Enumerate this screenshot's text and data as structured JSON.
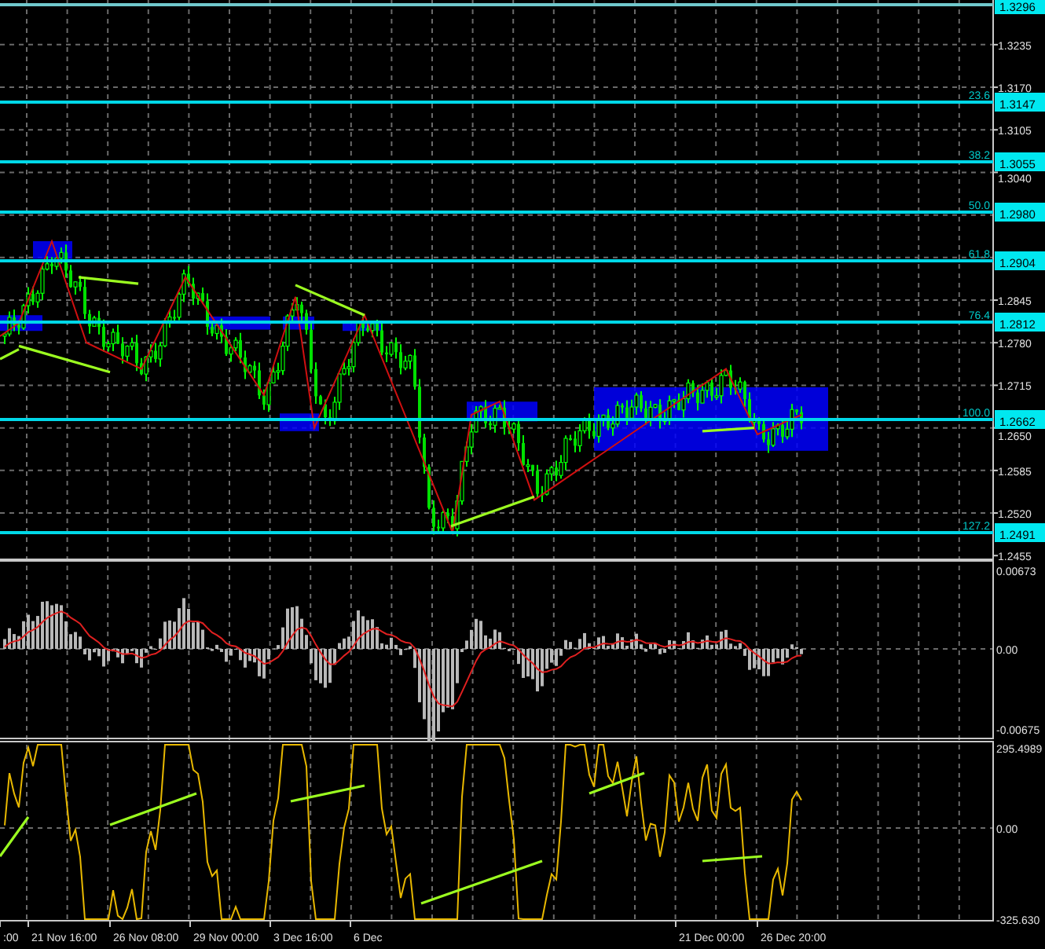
{
  "price_pane": {
    "axis_labels": [
      "1.3235",
      "1.3170",
      "1.3105",
      "1.3040",
      "1.2845",
      "1.2780",
      "1.2715",
      "1.2650",
      "1.2585",
      "1.2520",
      "1.2455"
    ],
    "levels": [
      {
        "price": "1.3296"
      },
      {
        "price": "1.3147",
        "fib": "23.6"
      },
      {
        "price": "1.3055",
        "fib": "38.2"
      },
      {
        "price": "1.2980",
        "fib": "50.0"
      },
      {
        "price": "1.2904",
        "fib": "61.8"
      },
      {
        "price": "1.2812",
        "fib": "76.4"
      },
      {
        "price": "1.2662",
        "fib": "100.0"
      },
      {
        "price": "1.2491",
        "fib": "127.2"
      }
    ]
  },
  "macd_pane": {
    "axis_labels": [
      "0.00673",
      "0.00",
      "-0.00675"
    ]
  },
  "cci_pane": {
    "axis_labels": [
      "295.4989",
      "0.00",
      "-325.630"
    ]
  },
  "time_axis": {
    "labels": [
      ":00",
      "21 Nov 16:00",
      "26 Nov 08:00",
      "29 Nov 00:00",
      "3 Dec 16:00",
      "6 Dec",
      "21 Dec 00:00",
      "26 Dec 20:00"
    ]
  }
}
